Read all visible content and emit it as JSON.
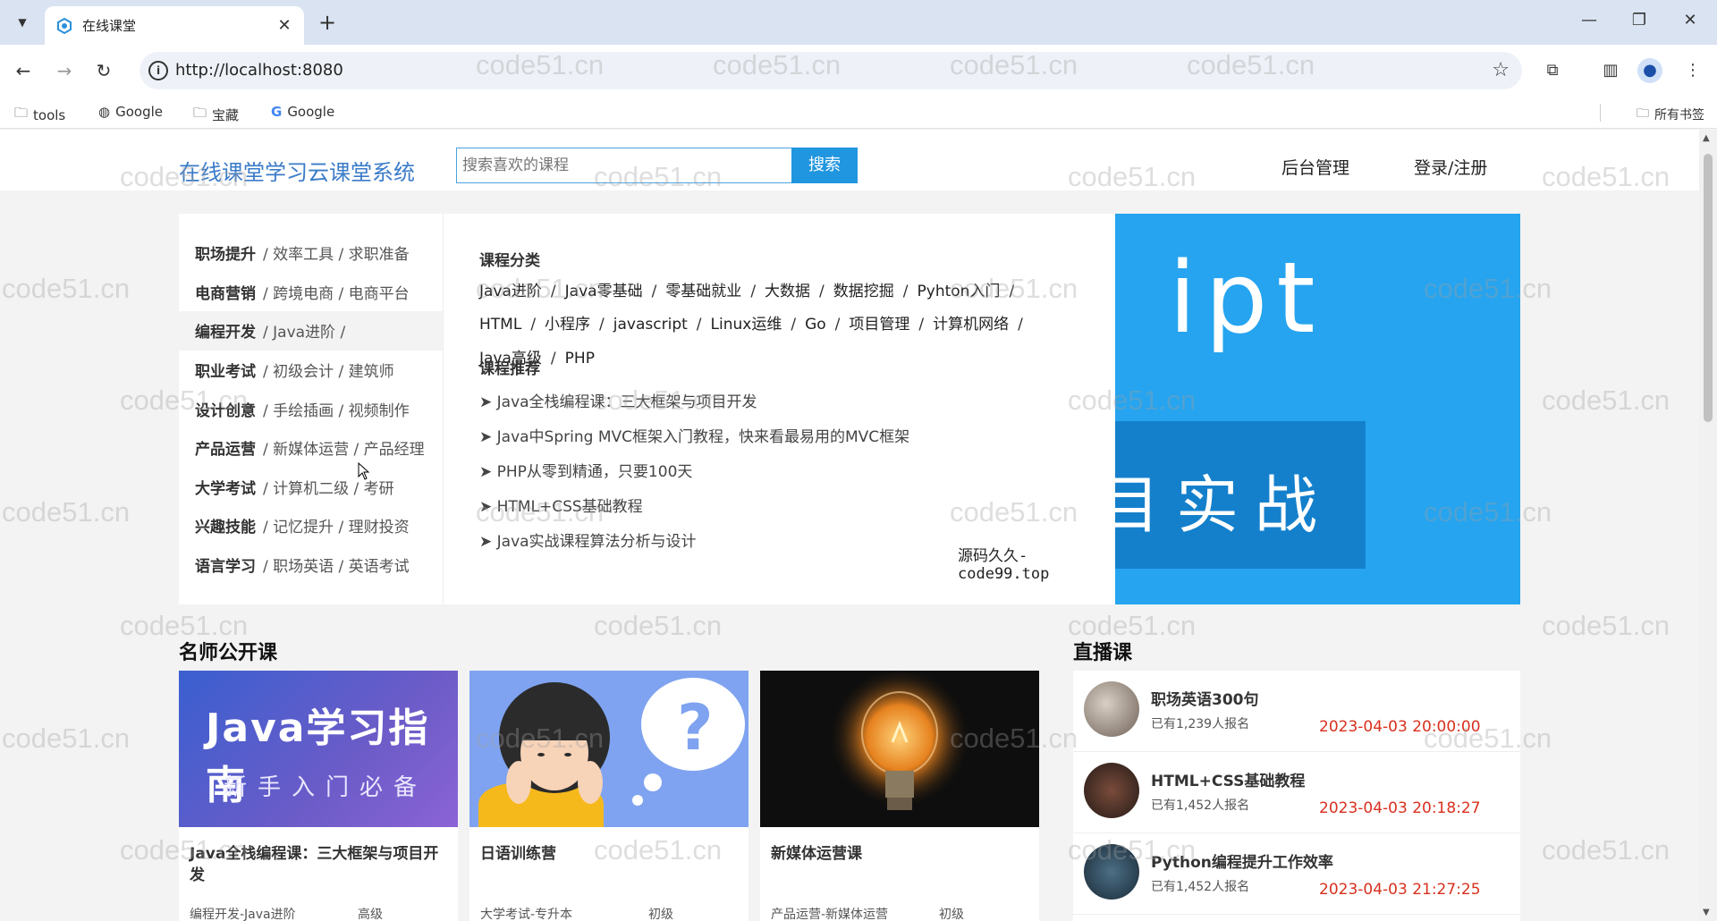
{
  "browser": {
    "tab_title": "在线课堂",
    "url": "http://localhost:8080",
    "bookmarks": [
      {
        "label": "tools",
        "icon": "folder-icon"
      },
      {
        "label": "Google",
        "icon": "globe-icon"
      },
      {
        "label": "宝藏",
        "icon": "folder-icon"
      },
      {
        "label": "Google",
        "icon": "google-icon"
      }
    ],
    "all_bookmarks": "所有书签"
  },
  "header": {
    "logo": "在线课堂学习云课堂系统",
    "search_placeholder": "搜索喜欢的课程",
    "search_button": "搜索",
    "admin_link": "后台管理",
    "login_link": "登录/注册"
  },
  "categories": [
    {
      "name": "职场提升",
      "subs": "/ 效率工具 / 求职准备"
    },
    {
      "name": "电商营销",
      "subs": "/ 跨境电商 / 电商平台"
    },
    {
      "name": "编程开发",
      "subs": "/ Java进阶  /"
    },
    {
      "name": "职业考试",
      "subs": "/ 初级会计 / 建筑师"
    },
    {
      "name": "设计创意",
      "subs": "/ 手绘插画 / 视频制作"
    },
    {
      "name": "产品运营",
      "subs": "/ 新媒体运营 / 产品经理"
    },
    {
      "name": "大学考试",
      "subs": "/ 计算机二级 / 考研"
    },
    {
      "name": "兴趣技能",
      "subs": "/ 记忆提升 / 理财投资"
    },
    {
      "name": "语言学习",
      "subs": "/ 职场英语 / 英语考试"
    }
  ],
  "detail": {
    "category_title": "课程分类",
    "tags_row1": [
      "Java进阶",
      "Java零基础",
      "零基础就业",
      "大数据",
      "数据挖掘",
      "Pyhton入门"
    ],
    "tags_row2": [
      "HTML",
      "小程序",
      "javascript",
      "Linux运维",
      "Go",
      "项目管理",
      "计算机网络"
    ],
    "tags_row3": [
      "Java高级",
      "PHP"
    ],
    "recommend_title": "课程推荐",
    "recommends": [
      "➤ Java全栈编程课：三大框架与项目开发",
      "➤ Java中Spring MVC框架入门教程，快来看最易用的MVC框架",
      "➤ PHP从零到精通，只要100天",
      "➤ HTML+CSS基础教程",
      "➤ Java实战课程算法分析与设计"
    ],
    "overlay": "源码久久-code99.top"
  },
  "banner": {
    "text1": "ipt",
    "text2": "目实战"
  },
  "sections": {
    "teachers": "名师公开课",
    "live": "直播课"
  },
  "courses": [
    {
      "title": "Java全栈编程课：三大框架与项目开发",
      "meta": "编程开发-Java进阶",
      "level": "高级",
      "img_text1": "Java学习指南",
      "img_text2": "新手入门必备"
    },
    {
      "title": "日语训练营",
      "meta": "大学考试-专升本",
      "level": "初级"
    },
    {
      "title": "新媒体运营课",
      "meta": "产品运营-新媒体运营",
      "level": "初级"
    }
  ],
  "live": [
    {
      "title": "职场英语300句",
      "count": "已有1,239人报名",
      "time": "2023-04-03 20:00:00"
    },
    {
      "title": "HTML+CSS基础教程",
      "count": "已有1,452人报名",
      "time": "2023-04-03 20:18:27"
    },
    {
      "title": "Python编程提升工作效率",
      "count": "已有1,452人报名",
      "time": "2023-04-03 21:27:25"
    }
  ],
  "watermark": "code51.cn",
  "colors": {
    "accent": "#2196e0",
    "live_time": "#d9301e",
    "banner": "#26a4ef"
  }
}
